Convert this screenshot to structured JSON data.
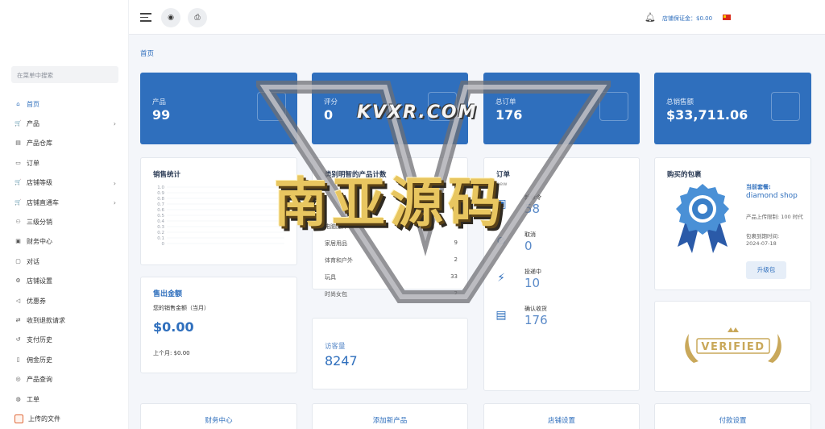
{
  "sidebar": {
    "search_placeholder": "在菜单中搜索",
    "items": [
      {
        "label": "首页",
        "icon": "home-icon",
        "active": true
      },
      {
        "label": "产品",
        "icon": "cart-icon",
        "has_children": true
      },
      {
        "label": "产品仓库",
        "icon": "warehouse-icon"
      },
      {
        "label": "订单",
        "icon": "money-icon"
      },
      {
        "label": "店铺等级",
        "icon": "cart-icon",
        "has_children": true
      },
      {
        "label": "店铺直通车",
        "icon": "cart-icon",
        "has_children": true
      },
      {
        "label": "三级分销",
        "icon": "users-icon"
      },
      {
        "label": "财务中心",
        "icon": "wallet-icon"
      },
      {
        "label": "对话",
        "icon": "chat-icon"
      },
      {
        "label": "店铺设置",
        "icon": "gear-icon"
      },
      {
        "label": "优惠券",
        "icon": "megaphone-icon"
      },
      {
        "label": "收到退款请求",
        "icon": "refund-icon"
      },
      {
        "label": "支付历史",
        "icon": "history-icon"
      },
      {
        "label": "佣金历史",
        "icon": "document-icon"
      },
      {
        "label": "产品查询",
        "icon": "search-circle-icon"
      },
      {
        "label": "工单",
        "icon": "ticket-icon"
      },
      {
        "label": "上传的文件",
        "icon": "upload-icon"
      }
    ]
  },
  "header": {
    "deposit_label": "店铺保证金：",
    "deposit_value": "$0.00",
    "globe_icon": "globe-icon",
    "print_icon": "printer-icon",
    "bell_icon": "bell-icon"
  },
  "breadcrumb": "首页",
  "stats": [
    {
      "label": "产品",
      "value": "99",
      "icon": "box-icon"
    },
    {
      "label": "评分",
      "value": "0",
      "icon": "star-icon"
    },
    {
      "label": "总订单",
      "value": "176",
      "icon": "clipboard-icon"
    },
    {
      "label": "总销售额",
      "value": "$33,711.06",
      "icon": "chart-up-icon"
    }
  ],
  "sales_stats": {
    "title": "销售统计",
    "ticks": [
      "1.0",
      "0.9",
      "0.8",
      "0.7",
      "0.6",
      "0.5",
      "0.4",
      "0.3",
      "0.2",
      "0.1",
      "0"
    ]
  },
  "sold_amount": {
    "title": "售出金额",
    "subtitle": "您的销售金额（当月）",
    "value": "$0.00",
    "last_month": "上个月: $0.00"
  },
  "category_counts": {
    "title": "类别明智的产品计数",
    "rows": [
      {
        "name": "电脑配件",
        "count": ""
      },
      {
        "name": "家居用品",
        "count": "9"
      },
      {
        "name": "体育和户外",
        "count": "2"
      },
      {
        "name": "玩具",
        "count": "33"
      },
      {
        "name": "时尚女包",
        "count": "2"
      }
    ]
  },
  "visitors": {
    "label": "访客量",
    "value": "8247"
  },
  "orders": {
    "title": "订单",
    "subtitle": "new",
    "items": [
      {
        "label": "新命令",
        "value": "58",
        "icon": "new-order-icon"
      },
      {
        "label": "取消",
        "value": "0",
        "icon": "cancel-icon"
      },
      {
        "label": "投递中",
        "value": "10",
        "icon": "running-icon"
      },
      {
        "label": "确认收货",
        "value": "176",
        "icon": "received-icon"
      }
    ]
  },
  "package": {
    "title": "购买的包裹",
    "current_label": "当前套餐:",
    "name": "diamond shop",
    "limit": "产品上传限制: 100 时代",
    "expiry_label": "包裹到期时间:",
    "expiry": "2024-07-18",
    "upgrade": "升级包"
  },
  "verified": "VERIFIED",
  "bottom_links": [
    "财务中心",
    "添加新产品",
    "店铺设置",
    "付款设置"
  ],
  "watermark": {
    "top": "KVXR.COM",
    "big": "南亚源码"
  },
  "colors": {
    "primary": "#2f6fbd",
    "flag": "#d92b1b"
  }
}
